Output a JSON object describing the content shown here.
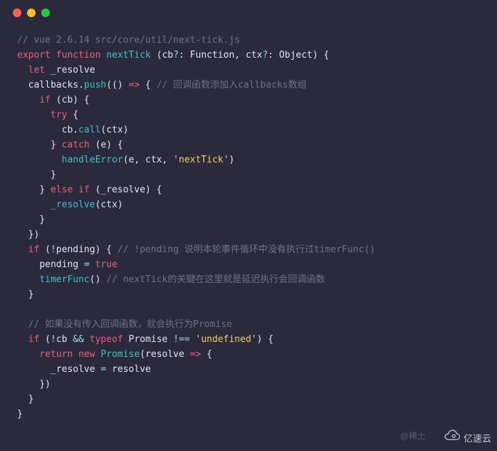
{
  "code": {
    "c1": "// vue 2.6.14 src/core/util/next-tick.js",
    "kw_export": "export",
    "kw_function": "function",
    "fn_name": "nextTick",
    "p1": "cb",
    "q1": "?",
    "colon1": ": ",
    "type1": "Function",
    "comma1": ", ",
    "p2": "ctx",
    "q2": "?",
    "colon2": ": ",
    "type2": "Object",
    "rparen": ")",
    "lbrace": " {",
    "kw_let": "let",
    "var_resolve": " _resolve",
    "callbacks": "callbacks",
    "dot": ".",
    "push": "push",
    "arrow_args": "(() ",
    "arrow": "=>",
    "arrow_brace": " { ",
    "c2": "// 回调函数添加入callbacks数组",
    "kw_if": "if",
    "cb_cond": " (cb) {",
    "kw_try": "try",
    "try_brace": " {",
    "cb_call_obj": "cb",
    "cb_call_dot": ".",
    "cb_call_method": "call",
    "cb_call_args": "(ctx)",
    "rbrace_try": "} ",
    "kw_catch": "catch",
    "catch_args": " (e) {",
    "handleError": "handleError",
    "handleError_args_open": "(e, ctx, ",
    "str_nextTick": "'nextTick'",
    "handleError_args_close": ")",
    "rbrace_catch": "}",
    "rbrace_if": "} ",
    "kw_else": "else",
    "kw_if2": " if",
    "elseif_cond": " (_resolve) {",
    "resolve_call": "_resolve",
    "resolve_args": "(ctx)",
    "rbrace_elseif": "}",
    "push_close": "})",
    "kw_if3": "if",
    "pending_cond_open": " (",
    "not1": "!",
    "pending_var": "pending",
    "pending_cond_close": ") { ",
    "c3": "// !pending 说明本轮事件循环中没有执行过timerFunc()",
    "pending_assign": "pending ",
    "eq1": "=",
    "true_val": " true",
    "timerFunc": "timerFunc",
    "timerFunc_args": "() ",
    "c4": "// nextTick的关键在这里就是延迟执行会回调函数",
    "rbrace_if3": "}",
    "c5": "// 如果没有传入回调函数，就会执行为Promise",
    "kw_if4": "if",
    "if4_open": " (",
    "not2": "!",
    "cb_var": "cb ",
    "and1": "&&",
    "typeof_kw": " typeof",
    "promise_var": " Promise ",
    "neq": "!==",
    "str_undef": " 'undefined'",
    "if4_close": ") {",
    "kw_return": "return",
    "kw_new": " new",
    "promise_ctor": " Promise",
    "promise_args_open": "(resolve ",
    "arrow2": "=>",
    "promise_args_brace": " {",
    "resolve_assign_l": "_resolve ",
    "eq2": "=",
    "resolve_assign_r": " resolve",
    "promise_close": "})",
    "rbrace_if4": "}",
    "rbrace_fn": "}"
  },
  "watermark1": "@稀土",
  "watermark2": "亿速云"
}
